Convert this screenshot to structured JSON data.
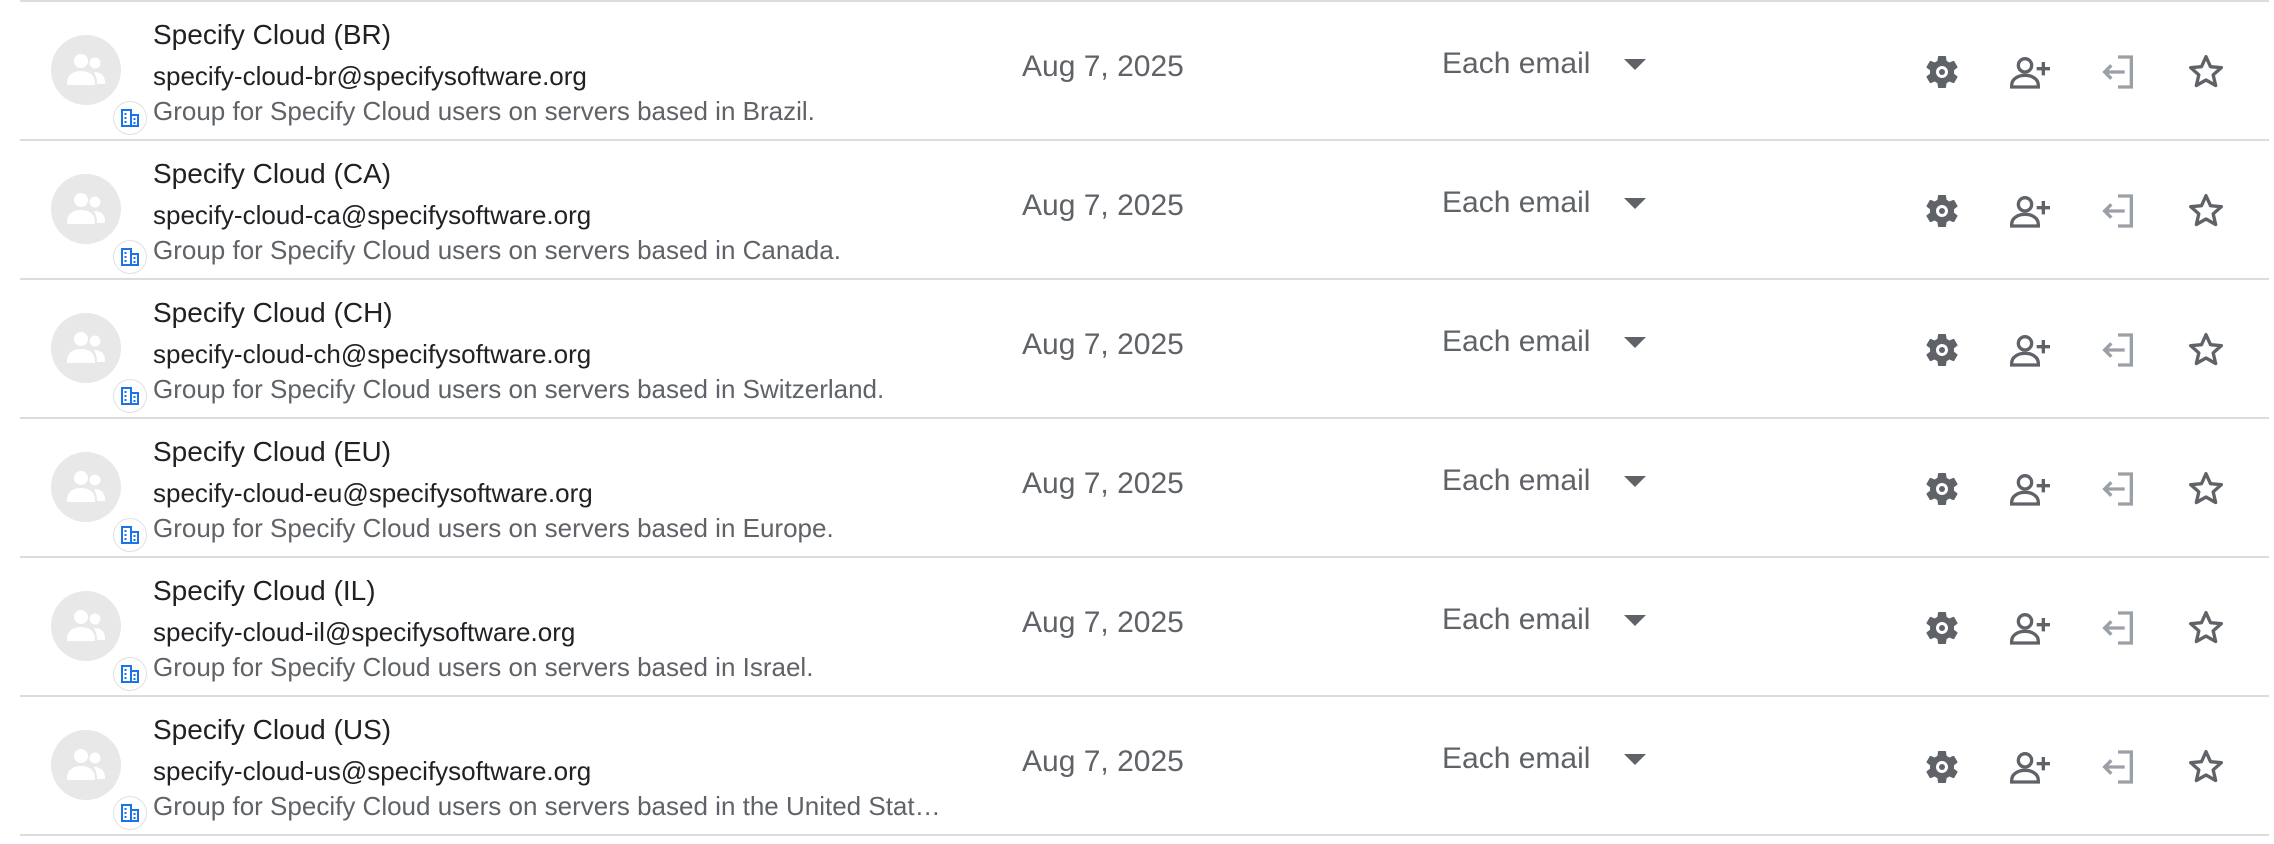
{
  "colors": {
    "divider": "#dadce0",
    "text_primary": "#202124",
    "text_secondary": "#5f6368",
    "badge_blue": "#1a73e8"
  },
  "icons": {
    "avatar": "group-people-icon",
    "badge": "organization-building-icon",
    "settings": "gear-icon",
    "add_member": "person-add-icon",
    "leave": "leave-group-icon",
    "favorite": "star-outline-icon"
  },
  "groups": [
    {
      "name": "Specify Cloud (BR)",
      "email": "specify-cloud-br@specifysoftware.org",
      "description": "Group for Specify Cloud users on servers based in Brazil.",
      "joined": "Aug 7, 2025",
      "subscription": "Each email"
    },
    {
      "name": "Specify Cloud (CA)",
      "email": "specify-cloud-ca@specifysoftware.org",
      "description": "Group for Specify Cloud users on servers based in Canada.",
      "joined": "Aug 7, 2025",
      "subscription": "Each email"
    },
    {
      "name": "Specify Cloud (CH)",
      "email": "specify-cloud-ch@specifysoftware.org",
      "description": "Group for Specify Cloud users on servers based in Switzerland.",
      "joined": "Aug 7, 2025",
      "subscription": "Each email"
    },
    {
      "name": "Specify Cloud (EU)",
      "email": "specify-cloud-eu@specifysoftware.org",
      "description": "Group for Specify Cloud users on servers based in Europe.",
      "joined": "Aug 7, 2025",
      "subscription": "Each email"
    },
    {
      "name": "Specify Cloud (IL)",
      "email": "specify-cloud-il@specifysoftware.org",
      "description": "Group for Specify Cloud users on servers based in Israel.",
      "joined": "Aug 7, 2025",
      "subscription": "Each email"
    },
    {
      "name": "Specify Cloud (US)",
      "email": "specify-cloud-us@specifysoftware.org",
      "description": "Group for Specify Cloud users on servers based in the United Stat…",
      "joined": "Aug 7, 2025",
      "subscription": "Each email"
    }
  ]
}
